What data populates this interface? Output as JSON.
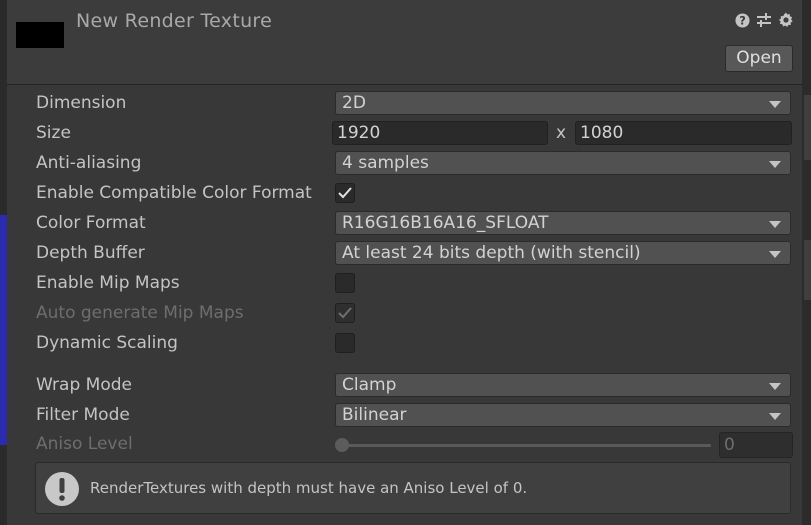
{
  "header": {
    "title": "New Render Texture",
    "open_label": "Open",
    "icons": [
      "help-icon",
      "preset-sliders-icon",
      "gear-icon"
    ]
  },
  "fields": {
    "dimension": {
      "label": "Dimension",
      "value": "2D"
    },
    "size": {
      "label": "Size",
      "width": "1920",
      "x": "x",
      "height": "1080"
    },
    "anti_aliasing": {
      "label": "Anti-aliasing",
      "value": "4 samples"
    },
    "compat_color": {
      "label": "Enable Compatible Color Format",
      "checked": true
    },
    "color_format": {
      "label": "Color Format",
      "value": "R16G16B16A16_SFLOAT"
    },
    "depth_buffer": {
      "label": "Depth Buffer",
      "value": "At least 24 bits depth (with stencil)"
    },
    "mip_maps": {
      "label": "Enable Mip Maps",
      "checked": false
    },
    "auto_mip": {
      "label": "Auto generate Mip Maps",
      "checked": true,
      "disabled": true
    },
    "dynamic_scaling": {
      "label": "Dynamic Scaling",
      "checked": false
    },
    "wrap_mode": {
      "label": "Wrap Mode",
      "value": "Clamp"
    },
    "filter_mode": {
      "label": "Filter Mode",
      "value": "Bilinear"
    },
    "aniso_level": {
      "label": "Aniso Level",
      "value": "0",
      "disabled": true
    }
  },
  "help": {
    "message": "RenderTextures with depth must have an Aniso Level of 0.",
    "icon": "warning-icon"
  }
}
